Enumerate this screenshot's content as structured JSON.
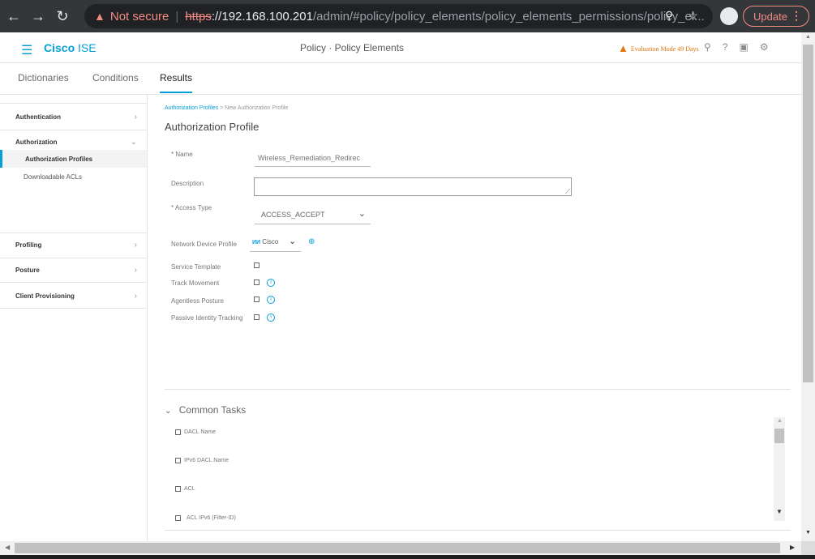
{
  "browser": {
    "not_secure": "Not secure",
    "url_scheme": "https",
    "url_host": "://192.168.100.201",
    "url_path": "/admin/#policy/policy_elements/policy_elements_permissions/policy_el...",
    "update_label": "Update"
  },
  "header": {
    "brand_cisco": "Cisco",
    "brand_ise": " ISE",
    "page_title": "Policy · Policy Elements",
    "eval_mode": "Evaluation Mode 49 Days"
  },
  "tabs": [
    {
      "label": "Dictionaries"
    },
    {
      "label": "Conditions"
    },
    {
      "label": "Results"
    }
  ],
  "sidebar": {
    "authentication": "Authentication",
    "authorization": "Authorization",
    "authorization_profiles": "Authorization Profiles",
    "downloadable_acls": "Downloadable ACLs",
    "profiling": "Profiling",
    "posture": "Posture",
    "client_provisioning": "Client Provisioning"
  },
  "breadcrumb": {
    "link": "Authorization Profiles",
    "sep": ">",
    "current": "New Authorization Profile"
  },
  "form": {
    "title": "Authorization Profile",
    "name_label": "* Name",
    "name_value": "Wireless_Remediation_Redirec",
    "description_label": "Description",
    "access_type_label": "* Access Type",
    "access_type_value": "ACCESS_ACCEPT",
    "ndp_label": "Network Device Profile",
    "ndp_logo": "ИИ",
    "ndp_value": "Cisco",
    "service_template_label": "Service Template",
    "track_movement_label": "Track Movement",
    "agentless_posture_label": "Agentless Posture",
    "passive_identity_label": "Passive Identity Tracking"
  },
  "common_tasks": {
    "header": "Common Tasks",
    "items": [
      "DACL Name",
      "IPv6 DACL Name",
      "ACL",
      "ACL IPv6 (Filter-ID)"
    ]
  },
  "colors": {
    "accent": "#049fd9",
    "warning": "#e2770d"
  }
}
